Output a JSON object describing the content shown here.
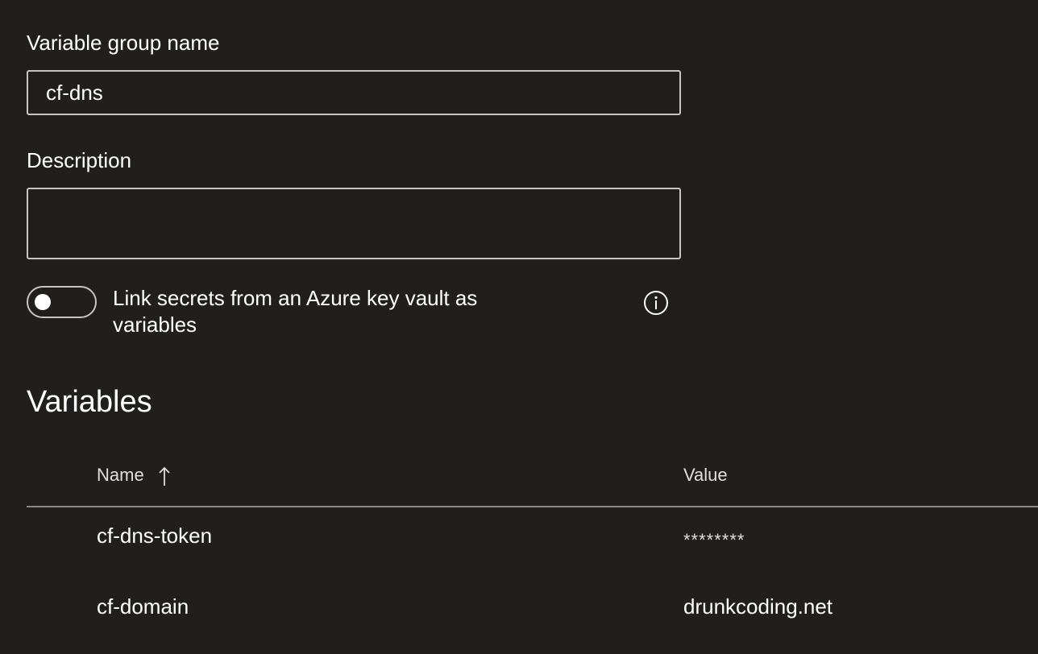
{
  "form": {
    "name_label": "Variable group name",
    "name_value": "cf-dns",
    "description_label": "Description",
    "description_value": "",
    "keyvault_toggle_label": "Link secrets from an Azure key vault as variables",
    "keyvault_toggle_on": false
  },
  "variables": {
    "title": "Variables",
    "columns": {
      "name": "Name",
      "value": "Value"
    },
    "sort_icon": "arrow-up-icon",
    "rows": [
      {
        "name": "cf-dns-token",
        "value": "********"
      },
      {
        "name": "cf-domain",
        "value": "drunkcoding.net"
      }
    ]
  },
  "colors": {
    "background": "#201f1e",
    "text": "#ffffff",
    "border": "#c8c6c4",
    "divider": "#8a8886"
  }
}
